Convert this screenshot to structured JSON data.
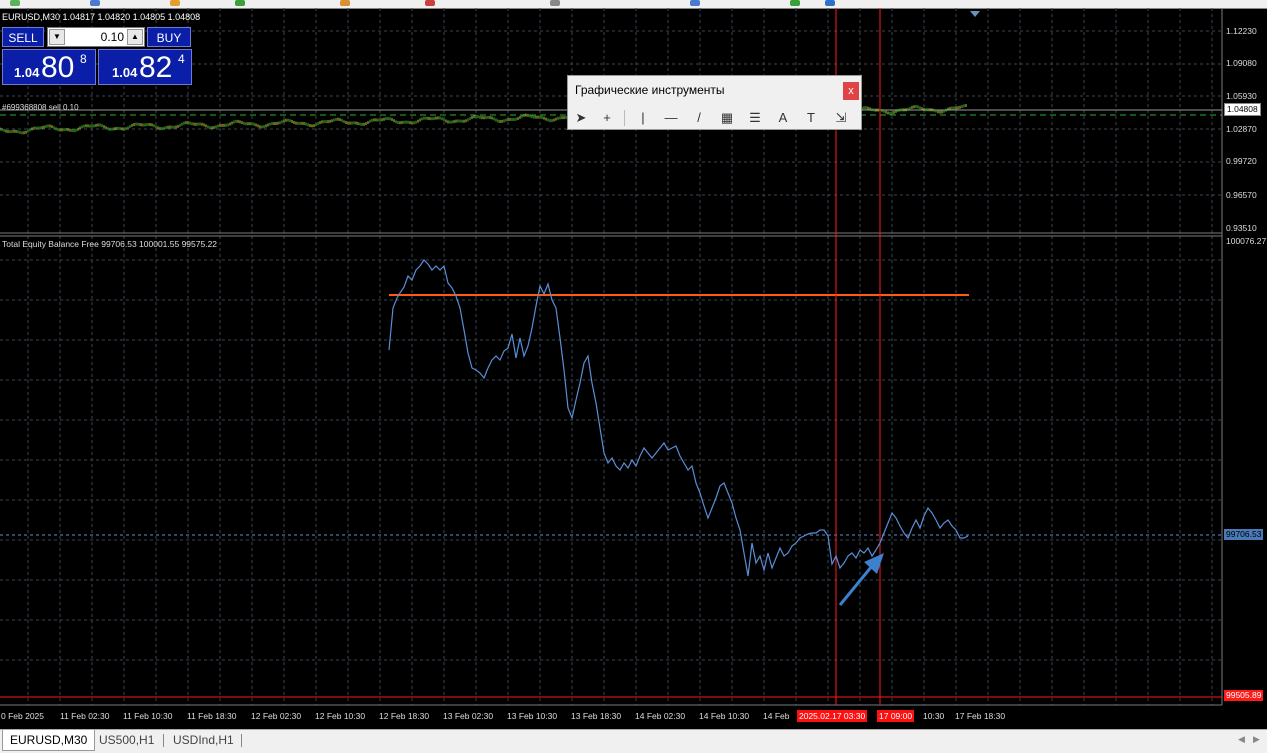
{
  "chart_title": "EURUSD,M30  1.04817 1.04820 1.04805 1.04808",
  "trade_panel": {
    "sell_label": "SELL",
    "buy_label": "BUY",
    "lot_value": "0.10",
    "bid": {
      "prefix": "1.04",
      "big": "80",
      "sup": "8"
    },
    "ask": {
      "prefix": "1.04",
      "big": "82",
      "sup": "4"
    }
  },
  "order_label": "#699368808 sell 0.10",
  "current_price_tag": "1.04808",
  "price_axis": [
    "1.12230",
    "1.09080",
    "1.05930",
    "1.02870",
    "0.99720",
    "0.96570",
    "0.93510"
  ],
  "indicator": {
    "label": "Total Equity Balance Free 99706.53 100001.55 99575.22",
    "axis_top": "100076.27",
    "equity_tag": "99706.53",
    "bottom_tag": "99505.89"
  },
  "time_axis": [
    "0 Feb 2025",
    "11 Feb 02:30",
    "11 Feb 10:30",
    "11 Feb 18:30",
    "12 Feb 02:30",
    "12 Feb 10:30",
    "12 Feb 18:30",
    "13 Feb 02:30",
    "13 Feb 10:30",
    "13 Feb 18:30",
    "14 Feb 02:30",
    "14 Feb 10:30",
    "14 Feb",
    "10:30",
    "17 Feb 18:30"
  ],
  "time_tags": [
    "2025.02.17 03:30",
    "17 09:00"
  ],
  "drawing_tools": {
    "title": "Графические инструменты",
    "close": "x",
    "tools": [
      {
        "icon": "cursor-arrow-icon",
        "glyph": "➤"
      },
      {
        "icon": "crosshair-icon",
        "glyph": "+"
      },
      {
        "icon": "vertical-line-icon",
        "glyph": "|"
      },
      {
        "icon": "horizontal-line-icon",
        "glyph": "—"
      },
      {
        "icon": "trendline-icon",
        "glyph": "/"
      },
      {
        "icon": "equidistant-channel-icon",
        "glyph": "▦"
      },
      {
        "icon": "fibonacci-icon",
        "glyph": "☰"
      },
      {
        "icon": "text-icon",
        "glyph": "A"
      },
      {
        "icon": "text-label-icon",
        "glyph": "T"
      },
      {
        "icon": "arrows-dropdown-icon",
        "glyph": "⇲"
      }
    ]
  },
  "tabs": [
    "EURUSD,M30",
    "US500,H1",
    "USDInd,H1"
  ],
  "colors": {
    "background": "#000000",
    "grid": "#3a4650",
    "equity_line": "#5a8ed6",
    "price_up": "#3ec63e",
    "price_down": "#c8c83a",
    "order_line": "#2faa2f",
    "red_lines": "#ff1a1a",
    "orange_line": "#ff5a14",
    "panel_blue": "#0a1ea8"
  }
}
